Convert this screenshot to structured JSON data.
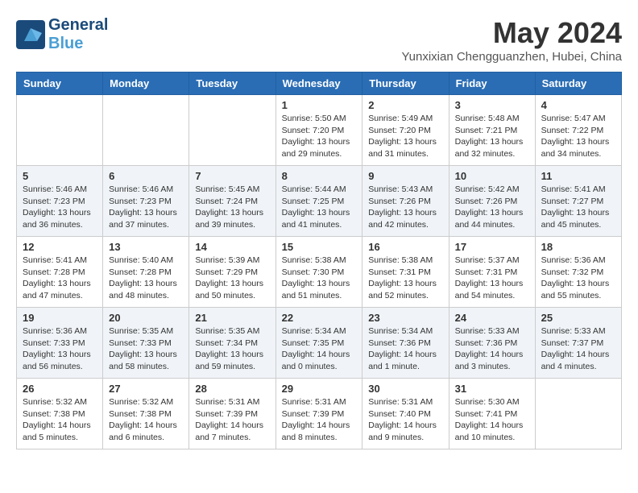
{
  "header": {
    "logo_line1": "General",
    "logo_line2": "Blue",
    "month_year": "May 2024",
    "location": "Yunxixian Chengguanzhen, Hubei, China"
  },
  "days_of_week": [
    "Sunday",
    "Monday",
    "Tuesday",
    "Wednesday",
    "Thursday",
    "Friday",
    "Saturday"
  ],
  "weeks": [
    [
      {
        "day": "",
        "info": ""
      },
      {
        "day": "",
        "info": ""
      },
      {
        "day": "",
        "info": ""
      },
      {
        "day": "1",
        "info": "Sunrise: 5:50 AM\nSunset: 7:20 PM\nDaylight: 13 hours\nand 29 minutes."
      },
      {
        "day": "2",
        "info": "Sunrise: 5:49 AM\nSunset: 7:20 PM\nDaylight: 13 hours\nand 31 minutes."
      },
      {
        "day": "3",
        "info": "Sunrise: 5:48 AM\nSunset: 7:21 PM\nDaylight: 13 hours\nand 32 minutes."
      },
      {
        "day": "4",
        "info": "Sunrise: 5:47 AM\nSunset: 7:22 PM\nDaylight: 13 hours\nand 34 minutes."
      }
    ],
    [
      {
        "day": "5",
        "info": "Sunrise: 5:46 AM\nSunset: 7:23 PM\nDaylight: 13 hours\nand 36 minutes."
      },
      {
        "day": "6",
        "info": "Sunrise: 5:46 AM\nSunset: 7:23 PM\nDaylight: 13 hours\nand 37 minutes."
      },
      {
        "day": "7",
        "info": "Sunrise: 5:45 AM\nSunset: 7:24 PM\nDaylight: 13 hours\nand 39 minutes."
      },
      {
        "day": "8",
        "info": "Sunrise: 5:44 AM\nSunset: 7:25 PM\nDaylight: 13 hours\nand 41 minutes."
      },
      {
        "day": "9",
        "info": "Sunrise: 5:43 AM\nSunset: 7:26 PM\nDaylight: 13 hours\nand 42 minutes."
      },
      {
        "day": "10",
        "info": "Sunrise: 5:42 AM\nSunset: 7:26 PM\nDaylight: 13 hours\nand 44 minutes."
      },
      {
        "day": "11",
        "info": "Sunrise: 5:41 AM\nSunset: 7:27 PM\nDaylight: 13 hours\nand 45 minutes."
      }
    ],
    [
      {
        "day": "12",
        "info": "Sunrise: 5:41 AM\nSunset: 7:28 PM\nDaylight: 13 hours\nand 47 minutes."
      },
      {
        "day": "13",
        "info": "Sunrise: 5:40 AM\nSunset: 7:28 PM\nDaylight: 13 hours\nand 48 minutes."
      },
      {
        "day": "14",
        "info": "Sunrise: 5:39 AM\nSunset: 7:29 PM\nDaylight: 13 hours\nand 50 minutes."
      },
      {
        "day": "15",
        "info": "Sunrise: 5:38 AM\nSunset: 7:30 PM\nDaylight: 13 hours\nand 51 minutes."
      },
      {
        "day": "16",
        "info": "Sunrise: 5:38 AM\nSunset: 7:31 PM\nDaylight: 13 hours\nand 52 minutes."
      },
      {
        "day": "17",
        "info": "Sunrise: 5:37 AM\nSunset: 7:31 PM\nDaylight: 13 hours\nand 54 minutes."
      },
      {
        "day": "18",
        "info": "Sunrise: 5:36 AM\nSunset: 7:32 PM\nDaylight: 13 hours\nand 55 minutes."
      }
    ],
    [
      {
        "day": "19",
        "info": "Sunrise: 5:36 AM\nSunset: 7:33 PM\nDaylight: 13 hours\nand 56 minutes."
      },
      {
        "day": "20",
        "info": "Sunrise: 5:35 AM\nSunset: 7:33 PM\nDaylight: 13 hours\nand 58 minutes."
      },
      {
        "day": "21",
        "info": "Sunrise: 5:35 AM\nSunset: 7:34 PM\nDaylight: 13 hours\nand 59 minutes."
      },
      {
        "day": "22",
        "info": "Sunrise: 5:34 AM\nSunset: 7:35 PM\nDaylight: 14 hours\nand 0 minutes."
      },
      {
        "day": "23",
        "info": "Sunrise: 5:34 AM\nSunset: 7:36 PM\nDaylight: 14 hours\nand 1 minute."
      },
      {
        "day": "24",
        "info": "Sunrise: 5:33 AM\nSunset: 7:36 PM\nDaylight: 14 hours\nand 3 minutes."
      },
      {
        "day": "25",
        "info": "Sunrise: 5:33 AM\nSunset: 7:37 PM\nDaylight: 14 hours\nand 4 minutes."
      }
    ],
    [
      {
        "day": "26",
        "info": "Sunrise: 5:32 AM\nSunset: 7:38 PM\nDaylight: 14 hours\nand 5 minutes."
      },
      {
        "day": "27",
        "info": "Sunrise: 5:32 AM\nSunset: 7:38 PM\nDaylight: 14 hours\nand 6 minutes."
      },
      {
        "day": "28",
        "info": "Sunrise: 5:31 AM\nSunset: 7:39 PM\nDaylight: 14 hours\nand 7 minutes."
      },
      {
        "day": "29",
        "info": "Sunrise: 5:31 AM\nSunset: 7:39 PM\nDaylight: 14 hours\nand 8 minutes."
      },
      {
        "day": "30",
        "info": "Sunrise: 5:31 AM\nSunset: 7:40 PM\nDaylight: 14 hours\nand 9 minutes."
      },
      {
        "day": "31",
        "info": "Sunrise: 5:30 AM\nSunset: 7:41 PM\nDaylight: 14 hours\nand 10 minutes."
      },
      {
        "day": "",
        "info": ""
      }
    ]
  ]
}
